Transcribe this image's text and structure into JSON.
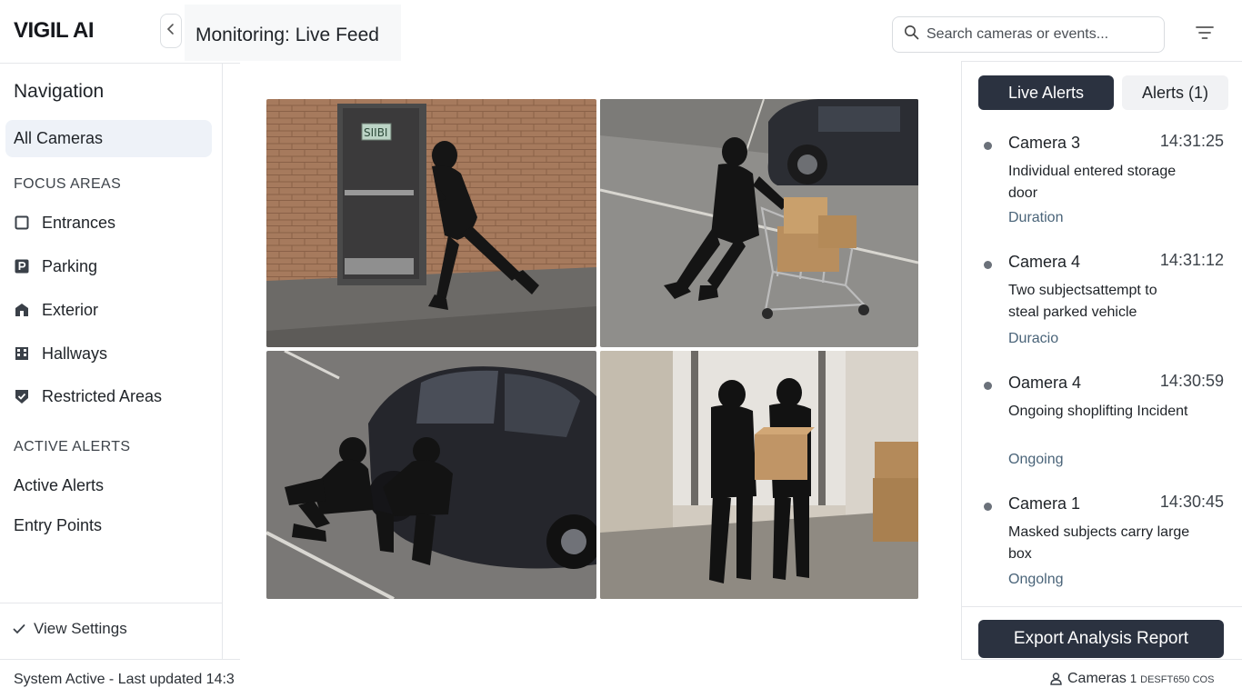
{
  "app": {
    "logo": "VIGIL AI",
    "page_title": "Monitoring: Live Feed"
  },
  "header": {
    "search_placeholder": "Search cameras or events...",
    "collapse_icon": "chevron-left-icon",
    "filter_icon": "filter-icon"
  },
  "sidebar": {
    "heading": "Navigation",
    "all_cameras": "All Cameras",
    "focus_label": "FOCUS AREAS",
    "focus_items": [
      {
        "label": "Entrances",
        "icon": "square-icon"
      },
      {
        "label": "Parking",
        "icon": "parking-icon"
      },
      {
        "label": "Exterior",
        "icon": "building-icon"
      },
      {
        "label": "Hallways",
        "icon": "grid-building-icon"
      },
      {
        "label": "Restricted Areas",
        "icon": "shield-check-icon"
      }
    ],
    "alerts_label": "ACTIVE ALERTS",
    "alert_links": [
      "Active Alerts",
      "Entry Points"
    ],
    "view_settings": "View Settings",
    "status": "System Active - Last updated 14:3"
  },
  "feeds": [
    {
      "scene": "masked person running from storage door",
      "sign": "SIIBI"
    },
    {
      "scene": "masked person pushing shopping cart with boxes"
    },
    {
      "scene": "two masked people crouching by parked car"
    },
    {
      "scene": "two masked people carrying box in hallway"
    }
  ],
  "right_panel": {
    "tabs": {
      "live": "Live Alerts",
      "alerts": "Alerts (1)"
    },
    "alerts": [
      {
        "camera": "Camera 3",
        "time": "14:31:25",
        "desc": "Individual entered storage door",
        "meta": "Duration"
      },
      {
        "camera": "Camera 4",
        "time": "14:31:12",
        "desc": "Two subjectsattempt to steal parked vehicle",
        "meta": "Duracio"
      },
      {
        "camera": "Oamera 4",
        "time": "14:30:59",
        "desc": "Ongoing shoplifting Incident",
        "meta": "Ongoing"
      },
      {
        "camera": "Camera 1",
        "time": "14:30:45",
        "desc": "Masked subjects carry large box",
        "meta": "Ongolng"
      }
    ],
    "export": "Export Analysis Report",
    "footer": {
      "label": "Cameras",
      "count": "1",
      "code": "DESFT650 COS",
      "icon": "user-icon"
    }
  },
  "colors": {
    "primary_dark": "#2b3240",
    "active_nav_bg": "#eef2f8",
    "meta_text": "#4a6479"
  }
}
